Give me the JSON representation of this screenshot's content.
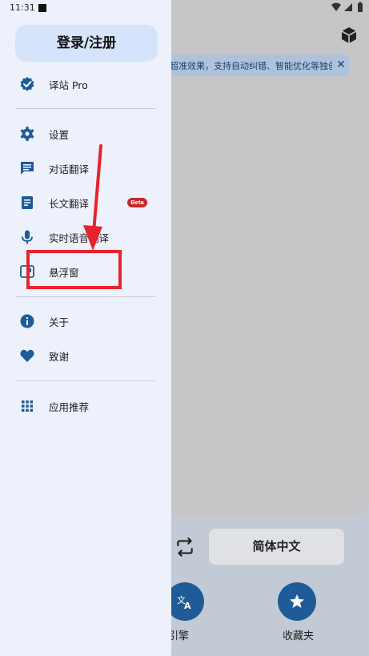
{
  "status_bar": {
    "time": "11:31"
  },
  "drawer": {
    "login_label": "登录/注册",
    "items": [
      {
        "label": "译站 Pro",
        "icon": "verified-badge-icon"
      },
      {
        "label": "设置",
        "icon": "gear-icon"
      },
      {
        "label": "对话翻译",
        "icon": "chat-bubble-icon"
      },
      {
        "label": "长文翻译",
        "icon": "document-icon",
        "badge": "Beta"
      },
      {
        "label": "实时语音翻译",
        "icon": "microphone-icon"
      },
      {
        "label": "悬浮窗",
        "icon": "floating-window-icon"
      },
      {
        "label": "关于",
        "icon": "info-icon"
      },
      {
        "label": "致谢",
        "icon": "heart-icon"
      },
      {
        "label": "应用推荐",
        "icon": "grid-apps-icon"
      }
    ]
  },
  "main": {
    "tip": "超准效果，支持自动纠错、智能优化等独创",
    "target_language": "简体中文",
    "engine_label": "设置引擎",
    "favorites_label": "收藏夹"
  },
  "colors": {
    "accent": "#1f5b97",
    "drawer_bg": "#edf1fb",
    "login_bg": "#d6e4fb",
    "beta_badge": "#c62828",
    "annotation": "#e8222e"
  }
}
